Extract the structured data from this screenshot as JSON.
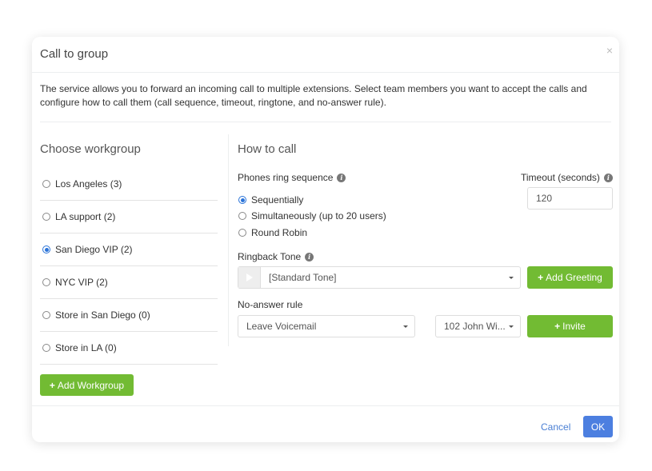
{
  "dialog": {
    "title": "Call to group",
    "close_icon": "×",
    "description": "The service allows you to forward an incoming call to multiple extensions. Select team members you want to accept the calls and configure how to call them (call sequence, timeout, ringtone, and no-answer rule)."
  },
  "workgroups": {
    "title": "Choose workgroup",
    "items": [
      {
        "label": "Los Angeles (3)",
        "selected": false
      },
      {
        "label": "LA support (2)",
        "selected": false
      },
      {
        "label": "San Diego VIP (2)",
        "selected": true
      },
      {
        "label": "NYC VIP (2)",
        "selected": false
      },
      {
        "label": "Store in San Diego (0)",
        "selected": false
      },
      {
        "label": "Store in LA (0)",
        "selected": false
      }
    ],
    "add_button": "Add Workgroup",
    "add_icon": "+"
  },
  "how_to_call": {
    "title": "How to call",
    "ring_sequence_label": "Phones ring sequence",
    "ring_options": [
      {
        "label": "Sequentially",
        "selected": true
      },
      {
        "label": "Simultaneously (up to 20 users)",
        "selected": false
      },
      {
        "label": "Round Robin",
        "selected": false
      }
    ],
    "timeout_label": "Timeout (seconds)",
    "timeout_value": "120",
    "ringback_label": "Ringback Tone",
    "ringback_value": "[Standard Tone]",
    "add_greeting_button": "Add Greeting",
    "no_answer_label": "No-answer rule",
    "no_answer_value": "Leave Voicemail",
    "extension_value": "102 John Wi...",
    "invite_button": "Invite",
    "info_icon": "i",
    "plus_icon": "+"
  },
  "footer": {
    "cancel": "Cancel",
    "ok": "OK"
  },
  "colors": {
    "green": "#72bb33",
    "blue": "#4c7fe0",
    "radio_selected": "#2a73d8"
  }
}
